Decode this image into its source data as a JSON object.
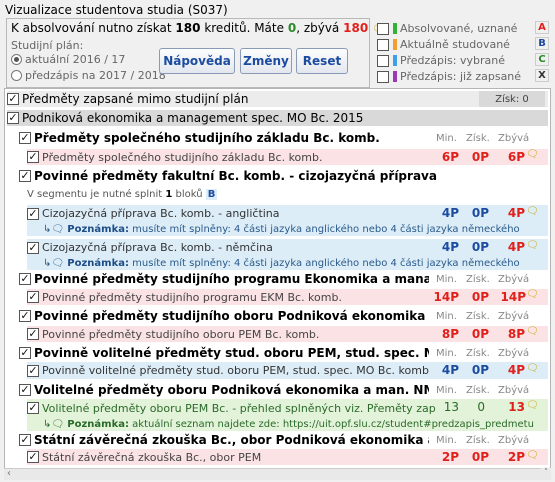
{
  "title": "Vizualizace studentova studia (S037)",
  "info": {
    "prefix": "K absolvování nutno získat",
    "total": "180",
    "credits_word": "kreditů. Máte",
    "have": "0",
    "remain_word": ", zbývá",
    "remain": "180"
  },
  "plan": {
    "label": "Studijní plán:",
    "options": [
      "aktuální 2016 / 17",
      "předzápis na 2017 / 2018"
    ]
  },
  "buttons": {
    "help": "Nápověda",
    "changes": "Změny",
    "reset": "Reset"
  },
  "legend": [
    {
      "label": "Absolvované, uznané",
      "color": "#33b233",
      "letter": "A",
      "letter_color": "#e0201a"
    },
    {
      "label": "Aktuálně studované",
      "color": "#f0a030",
      "letter": "B",
      "letter_color": "#1c4ca0"
    },
    {
      "label": "Předzápis: vybrané",
      "color": "#3fa0e6",
      "letter": "C",
      "letter_color": "#2a8a2a"
    },
    {
      "label": "Předzápis: již zapsané",
      "color": "#9b38b8",
      "letter": "X",
      "letter_color": "#333"
    }
  ],
  "headers": {
    "min": "Min.",
    "get": "Získ.",
    "left": "Zbývá"
  },
  "rows": [
    {
      "type": "top",
      "label": "Předměty zapsané mimo studijní plán",
      "extra": "Získ: 0"
    },
    {
      "type": "top",
      "label": "Podniková ekonomika a management spec. MO Bc. 2015"
    },
    {
      "type": "sect",
      "label": "Předměty společného studijního základu Bc. komb."
    },
    {
      "type": "item",
      "color": "pink",
      "label": "Předměty společného studijního základu Bc. komb.",
      "min": "6P",
      "get": "0P",
      "left": "6P"
    },
    {
      "type": "sect",
      "label": "Povinné předměty fakultní Bc. komb. - cizojazyčná příprava"
    },
    {
      "type": "info",
      "label": "V segmentu je nutné splnit",
      "count": "1",
      "unit": "bloků",
      "tag": "B"
    },
    {
      "type": "item",
      "color": "blue",
      "label": "Cizojazyčná příprava Bc. komb. - angličtina",
      "min": "4P",
      "get": "0P",
      "left": "4P"
    },
    {
      "type": "note",
      "color": "blue",
      "label": "Poznámka:",
      "text": "musíte mít splněny: 4 části jazyka anglického nebo 4 části jazyka německého"
    },
    {
      "type": "item",
      "color": "blue",
      "label": "Cizojazyčná příprava Bc. komb. - němčina",
      "min": "4P",
      "get": "0P",
      "left": "4P"
    },
    {
      "type": "note",
      "color": "blue",
      "label": "Poznámka:",
      "text": "musíte mít splněny: 4 části jazyka anglického nebo 4 části jazyka německého"
    },
    {
      "type": "sect",
      "label": "Povinné předměty studijního programu Ekonomika a managem"
    },
    {
      "type": "item",
      "color": "pink",
      "label": "Povinné předměty studijního programu EKM Bc. komb.",
      "min": "14P",
      "get": "0P",
      "left": "14P"
    },
    {
      "type": "sect",
      "label": "Povinné předměty studijního oboru Podniková ekonomika a man"
    },
    {
      "type": "item",
      "color": "pink",
      "label": "Povinné předměty studijního oboru PEM Bc. komb.",
      "min": "8P",
      "get": "0P",
      "left": "8P"
    },
    {
      "type": "sect",
      "label": "Povinně volitelné předměty stud. oboru PEM, stud. spec. Market"
    },
    {
      "type": "item",
      "color": "blue",
      "label": "Povinně volitelné předměty stud. oboru PEM, stud. spec. MO Bc. komb",
      "min": "4P",
      "get": "0P",
      "left": "4P"
    },
    {
      "type": "sect",
      "label": "Volitelné předměty oboru Podniková ekonomika a man. NMg."
    },
    {
      "type": "item",
      "color": "lgreen",
      "label": "Volitelné předměty oboru PEM Bc. - přehled splněných viz. Přeměty zap",
      "min": "13",
      "get": "0",
      "left": "13"
    },
    {
      "type": "note",
      "color": "lgreen",
      "label": "Poznámka:",
      "text": "aktuální seznam najdete zde: https://uit.opf.slu.cz/student#predzapis_predmetu"
    },
    {
      "type": "sect",
      "label": "Státní závěrečná zkouška Bc., obor Podniková ekonomika a mana"
    },
    {
      "type": "item",
      "color": "pink",
      "label": "Státní závěrečná zkouška Bc., obor PEM",
      "min": "2P",
      "get": "0P",
      "left": "2P"
    }
  ]
}
